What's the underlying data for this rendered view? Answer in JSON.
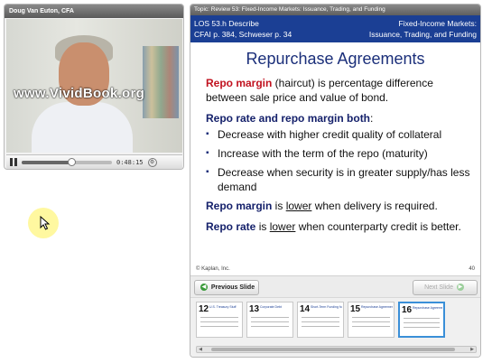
{
  "video": {
    "presenter": "Doug Van Euton, CFA",
    "watermark": "www.VividBook.org",
    "time": "0:48:15",
    "progress": 0.55
  },
  "slide": {
    "topic": "Topic: Review 53: Fixed-Income Markets: Issuance, Trading, and Funding",
    "header_left_1": "LOS 53.h Describe",
    "header_left_2": "CFAI p. 384, Schweser p. 34",
    "header_right_1": "Fixed-Income Markets:",
    "header_right_2": "Issuance, Trading, and Funding",
    "title": "Repurchase Agreements",
    "p1_bold": "Repo margin",
    "p1_rest": " (haircut) is percentage difference between sale price and value of bond.",
    "p2_bold": "Repo rate and repo margin both",
    "p2_rest": ":",
    "bullets": [
      "Decrease with higher credit quality of collateral",
      "Increase with the term of the repo (maturity)",
      "Decrease when security is in greater supply/has less demand"
    ],
    "p3_bold": "Repo margin",
    "p3_mid": " is ",
    "p3_u": "lower",
    "p3_end": " when delivery is required.",
    "p4_bold": "Repo rate",
    "p4_mid": " is ",
    "p4_u": "lower",
    "p4_end": " when counterparty credit is better.",
    "copyright": "© Kaplan, Inc.",
    "page": "40"
  },
  "nav": {
    "prev": "Previous Slide",
    "next": "Next Slide"
  },
  "thumbnails": [
    {
      "num": "12",
      "caption": "U.S. Treasury Stuff"
    },
    {
      "num": "13",
      "caption": "Corporate Debt"
    },
    {
      "num": "14",
      "caption": "Short-Term Funding for Banks"
    },
    {
      "num": "15",
      "caption": "Repurchase Agreements"
    },
    {
      "num": "16",
      "caption": "Repurchase Agreements"
    }
  ]
}
